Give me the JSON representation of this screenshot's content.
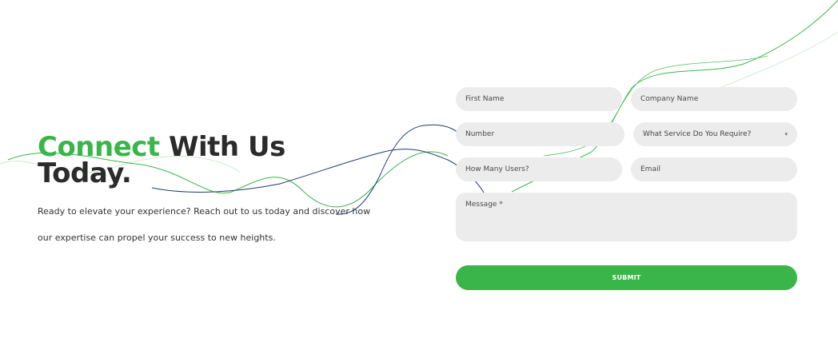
{
  "hero": {
    "title_accent": "Connect",
    "title_rest": " With Us",
    "title_line2": "Today.",
    "description": "Ready to elevate your experience? Reach out to us today and discover how our expertise can propel your success to new heights."
  },
  "form": {
    "first_name_placeholder": "First Name",
    "company_name_placeholder": "Company Name",
    "number_placeholder": "Number",
    "service_select_value": "What Service Do You Require?",
    "users_placeholder": "How Many Users?",
    "email_placeholder": "Email",
    "message_placeholder": "Message *",
    "submit_label": "SUBMIT"
  },
  "colors": {
    "accent": "#3ab54a",
    "navy_line": "#1f3b6e",
    "field_bg": "#ececec",
    "heading": "#2b2b2b"
  },
  "icons": {
    "select_caret": "▾"
  }
}
